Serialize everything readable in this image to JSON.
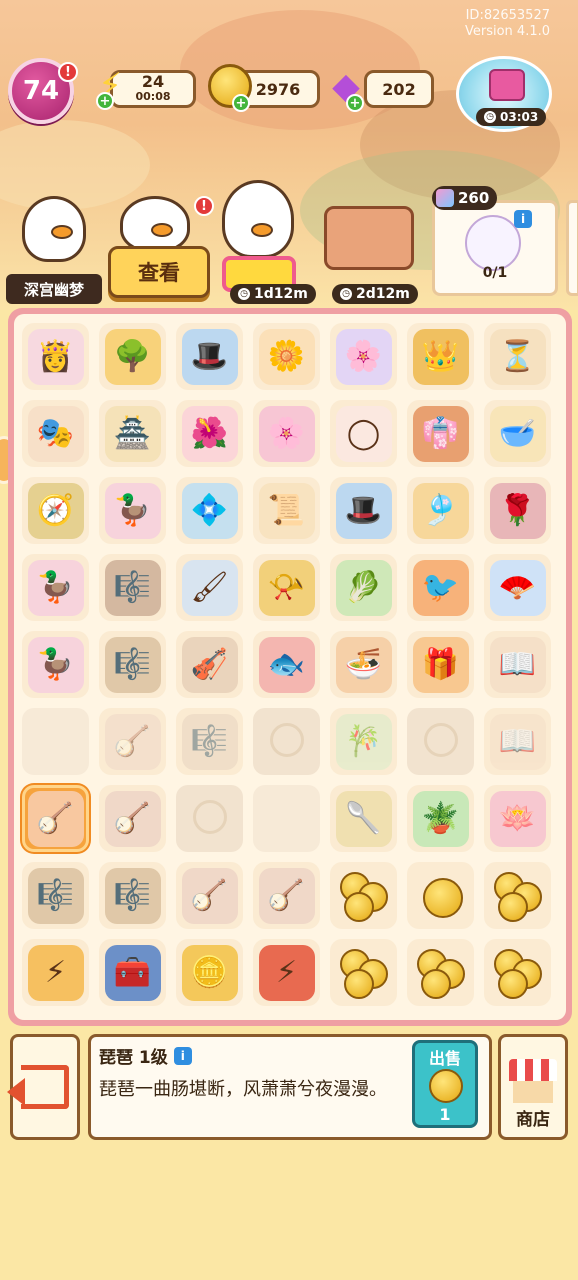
{
  "meta": {
    "id": "ID:82653527",
    "version": "Version 4.1.0"
  },
  "header": {
    "level": "74",
    "level_alert": "!",
    "energy": {
      "value": "24",
      "timer": "00:08"
    },
    "coins": "2976",
    "gems": "202",
    "gift_timer": "03:03"
  },
  "characters": {
    "name_plate": "深宫幽梦",
    "view_button": "查看",
    "alert": "!",
    "queue_timer_1": "1d12m",
    "queue_timer_2": "2d12m"
  },
  "order": {
    "reward": "260",
    "count": "0/1",
    "info": "i"
  },
  "board": {
    "rows": [
      [
        {
          "name": "consort-portrait",
          "glyph": "👸",
          "color": "#f7d9e0"
        },
        {
          "name": "osmanthus-tree",
          "glyph": "🌳",
          "color": "#f8d27a"
        },
        {
          "name": "eunuch-official",
          "glyph": "🎩",
          "color": "#bcd8f0"
        },
        {
          "name": "flower-hairpin",
          "glyph": "🌼",
          "color": "#fbe0b8"
        },
        {
          "name": "flower-plate",
          "glyph": "🌸",
          "color": "#e3d5f5"
        },
        {
          "name": "golden-phoenix-crown",
          "glyph": "👑",
          "color": "#f0c060"
        },
        {
          "name": "hourglass",
          "glyph": "⏳",
          "color": "#f6e1c0"
        }
      ],
      [
        {
          "name": "opera-duck",
          "glyph": "🎭",
          "color": "#f7e0c8"
        },
        {
          "name": "palace-pavilion",
          "glyph": "🏯",
          "color": "#f5e2b8"
        },
        {
          "name": "peony-flower",
          "glyph": "🌺",
          "color": "#fbd5d8"
        },
        {
          "name": "plum-blossom-tree",
          "glyph": "🌸",
          "color": "#f7c6d4"
        },
        {
          "name": "jade-bangle",
          "glyph": "◯",
          "color": "#fbe8e0"
        },
        {
          "name": "embroidered-robe",
          "glyph": "👘",
          "color": "#e8a070"
        },
        {
          "name": "powder-box",
          "glyph": "🥣",
          "color": "#f8e5b8"
        }
      ],
      [
        {
          "name": "golden-compass",
          "glyph": "🧭",
          "color": "#e5d090"
        },
        {
          "name": "consort-duck",
          "glyph": "🦆",
          "color": "#f7d3dc"
        },
        {
          "name": "blue-floral-headdress",
          "glyph": "💠",
          "color": "#c5e0ef"
        },
        {
          "name": "poem-scroll",
          "glyph": "📜",
          "color": "#f8e3c0"
        },
        {
          "name": "eunuch-official-2",
          "glyph": "🎩",
          "color": "#bcd8f0"
        },
        {
          "name": "golden-knot-ornament",
          "glyph": "🎐",
          "color": "#f7d79a"
        },
        {
          "name": "rose-comb",
          "glyph": "🌹",
          "color": "#e8b6b8"
        }
      ],
      [
        {
          "name": "consort-duck-2",
          "glyph": "🦆",
          "color": "#f7d3dc"
        },
        {
          "name": "guzheng",
          "glyph": "🎼",
          "color": "#d4b8a0"
        },
        {
          "name": "brush-ink",
          "glyph": "🖌",
          "color": "#d8e4f0"
        },
        {
          "name": "golden-horn",
          "glyph": "📯",
          "color": "#f2d07a"
        },
        {
          "name": "jade-cabbage",
          "glyph": "🥬",
          "color": "#cfe8b8"
        },
        {
          "name": "golden-phoenix",
          "glyph": "🐦",
          "color": "#f7b27a"
        },
        {
          "name": "silk-fan",
          "glyph": "🪭",
          "color": "#cfe2f7"
        }
      ],
      [
        {
          "name": "consort-duck-3",
          "glyph": "🦆",
          "color": "#f7d3dc"
        },
        {
          "name": "guzheng-2",
          "glyph": "🎼",
          "color": "#e0c8a8"
        },
        {
          "name": "konghou-harp",
          "glyph": "🎻",
          "color": "#ead4bc"
        },
        {
          "name": "red-goldfish-plate",
          "glyph": "🐟",
          "color": "#f4b6b0"
        },
        {
          "name": "food-bowl",
          "glyph": "🍜",
          "color": "#f6d0a8"
        },
        {
          "name": "silk-parcel",
          "glyph": "🎁",
          "color": "#f8c890"
        },
        {
          "name": "reading-duck",
          "glyph": "📖",
          "color": "#f5e0c8"
        }
      ],
      [
        {
          "name": "empty",
          "glyph": "",
          "color": "",
          "state": "empty"
        },
        {
          "name": "pipa-faded",
          "glyph": "🪕",
          "color": "#f0d8c8",
          "state": "faded"
        },
        {
          "name": "guzheng-faded",
          "glyph": "🎼",
          "color": "#e8d4c0",
          "state": "faded"
        },
        {
          "name": "locked",
          "glyph": "",
          "color": "",
          "state": "locked"
        },
        {
          "name": "bamboo-flute",
          "glyph": "🎋",
          "color": "#d8ecc8",
          "state": "faded"
        },
        {
          "name": "locked",
          "glyph": "",
          "color": "",
          "state": "locked"
        },
        {
          "name": "reading-duck-faded",
          "glyph": "📖",
          "color": "#f5e0c8",
          "state": "faded"
        }
      ],
      [
        {
          "name": "pipa-selected",
          "glyph": "🪕",
          "color": "#f8c8a0",
          "state": "selected"
        },
        {
          "name": "pipa",
          "glyph": "🪕",
          "color": "#f0d8c8"
        },
        {
          "name": "locked",
          "glyph": "",
          "color": "",
          "state": "locked"
        },
        {
          "name": "empty",
          "glyph": "",
          "color": "",
          "state": "empty"
        },
        {
          "name": "jade-spatula",
          "glyph": "🥄",
          "color": "#f0e0b0"
        },
        {
          "name": "potted-jade-plant",
          "glyph": "🪴",
          "color": "#c8e8b8"
        },
        {
          "name": "lotus-pot",
          "glyph": "🪷",
          "color": "#f7c8d0"
        }
      ],
      [
        {
          "name": "guzheng-small",
          "glyph": "🎼",
          "color": "#e0c8a8"
        },
        {
          "name": "guzheng-small-2",
          "glyph": "🎼",
          "color": "#e0c8a8"
        },
        {
          "name": "pipa-small",
          "glyph": "🪕",
          "color": "#f0d8c8"
        },
        {
          "name": "pipa-small-2",
          "glyph": "🪕",
          "color": "#f0d8c8"
        },
        {
          "name": "coin-pile",
          "glyph": "",
          "color": "",
          "state": "coins3"
        },
        {
          "name": "coin-single",
          "glyph": "",
          "color": "",
          "state": "coins1"
        },
        {
          "name": "coin-pile-2",
          "glyph": "",
          "color": "",
          "state": "coins3"
        }
      ],
      [
        {
          "name": "energy-chest",
          "glyph": "⚡",
          "color": "#f6c060"
        },
        {
          "name": "blue-treasure-chest",
          "glyph": "🧰",
          "color": "#6c90c8"
        },
        {
          "name": "coin-amulet",
          "glyph": "🪙",
          "color": "#f4c85a"
        },
        {
          "name": "palace-energy-chest",
          "glyph": "⚡",
          "color": "#e86a50"
        },
        {
          "name": "coin-pile-3",
          "glyph": "",
          "color": "",
          "state": "coins3"
        },
        {
          "name": "coin-stack",
          "glyph": "",
          "color": "",
          "state": "coins3"
        },
        {
          "name": "coin-heap",
          "glyph": "",
          "color": "",
          "state": "coins3"
        }
      ]
    ]
  },
  "info_panel": {
    "title": "琵琶 1级",
    "description": "琵琶一曲肠堪断，风萧萧兮夜漫漫。",
    "sell_label": "出售",
    "sell_price": "1",
    "shop_label": "商店",
    "info": "i"
  },
  "colors": {
    "board_border": "#ef9fa3",
    "background": "#fbe7a5",
    "level_badge": "#c7318a",
    "sell_button": "#3cc2c9",
    "selected_cell": "#f6a33d"
  }
}
